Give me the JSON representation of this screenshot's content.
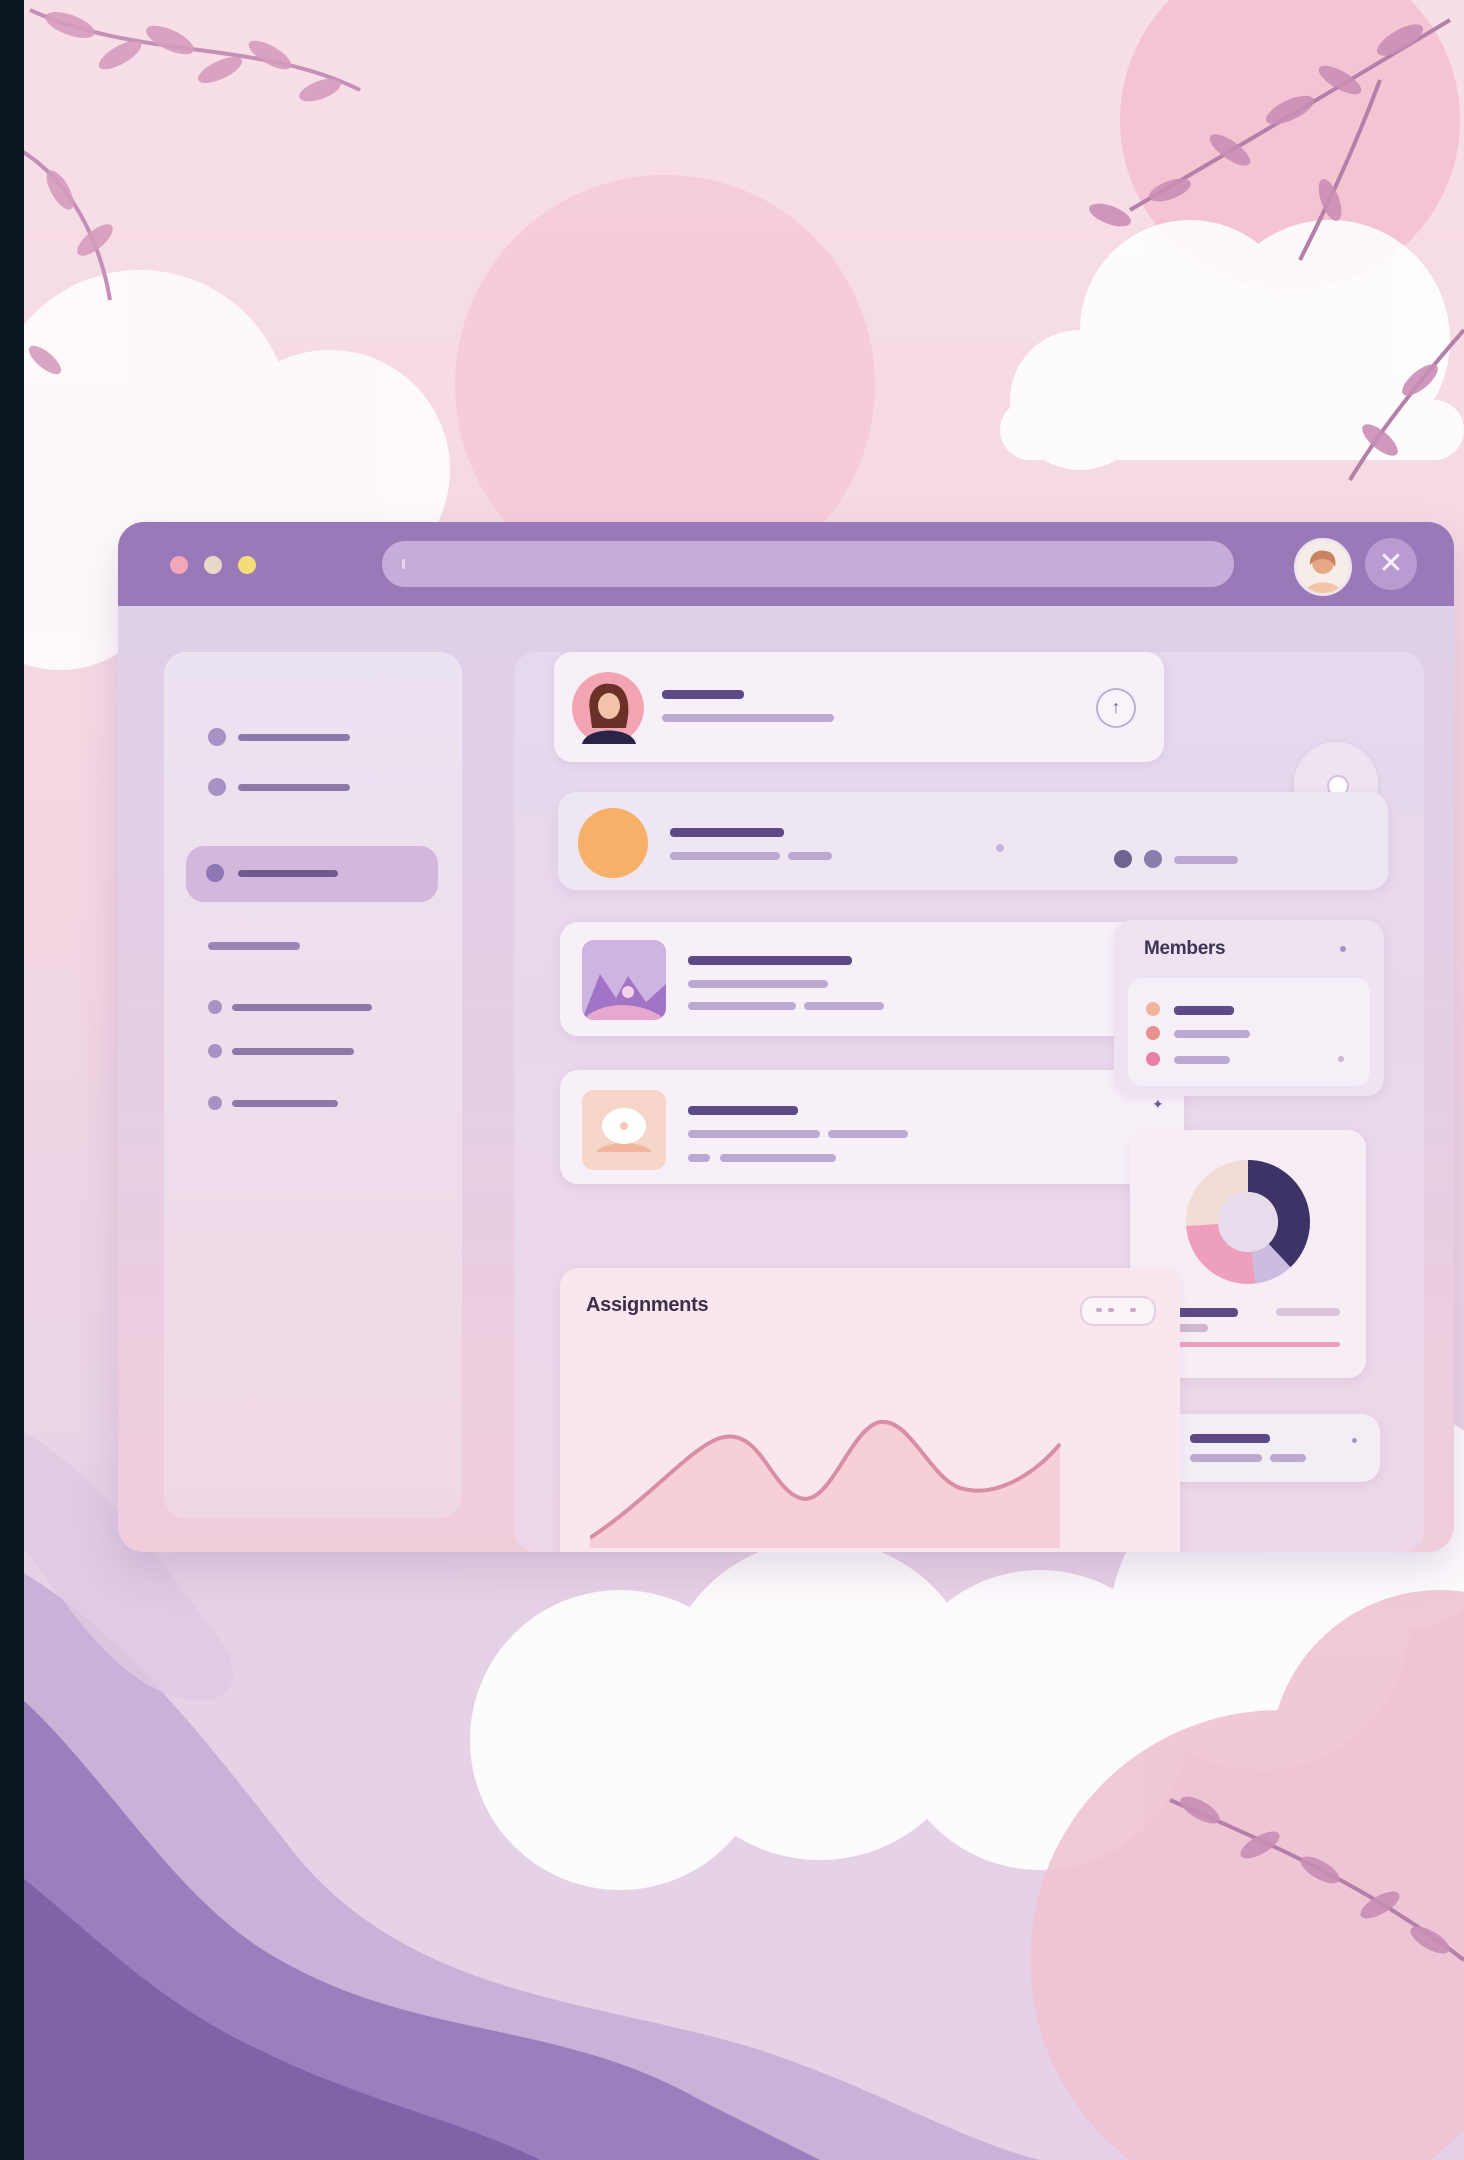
{
  "window": {
    "controls": [
      "close-dot",
      "minimize-dot",
      "maximize-dot"
    ],
    "close_glyph": "✕"
  },
  "cards": {
    "members_title": "Members",
    "assignments_title": "Assignments"
  },
  "colors": {
    "titlebar": "#9a79b9",
    "accent_dark": "#5b4a86",
    "sidebar_active": "#d4b7dd",
    "orange_avatar": "#f6b067",
    "pink": "#ee9fbd"
  },
  "chart_data": {
    "type": "pie",
    "title": "",
    "slices": [
      {
        "label": "",
        "value": 38,
        "color": "#3d3366"
      },
      {
        "label": "",
        "value": 10,
        "color": "#cbbde0"
      },
      {
        "label": "",
        "value": 26,
        "color": "#ee9fbd"
      },
      {
        "label": "",
        "value": 26,
        "color": "#f2ddd6"
      }
    ]
  }
}
